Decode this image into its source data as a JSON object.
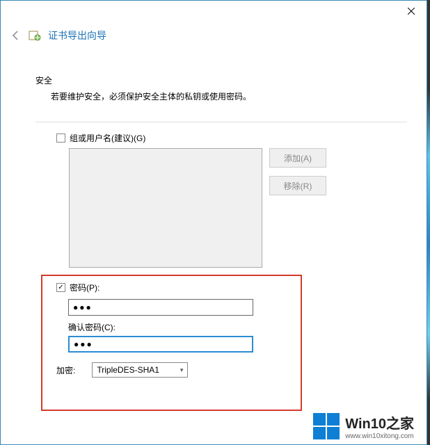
{
  "window": {
    "title": "证书导出向导"
  },
  "section": {
    "title": "安全",
    "description": "若要维护安全，必须保护安全主体的私钥或使用密码。"
  },
  "group": {
    "checkbox_label": "组或用户名(建议)(G)"
  },
  "buttons": {
    "add": "添加(A)",
    "remove": "移除(R)"
  },
  "password": {
    "checkbox_label": "密码(P):",
    "value": "●●●",
    "confirm_label": "确认密码(C):",
    "confirm_value": "●●●"
  },
  "encryption": {
    "label": "加密:",
    "selected": "TripleDES-SHA1"
  },
  "watermark": {
    "brand": "Win10之家",
    "url": "www.win10xitong.com"
  }
}
